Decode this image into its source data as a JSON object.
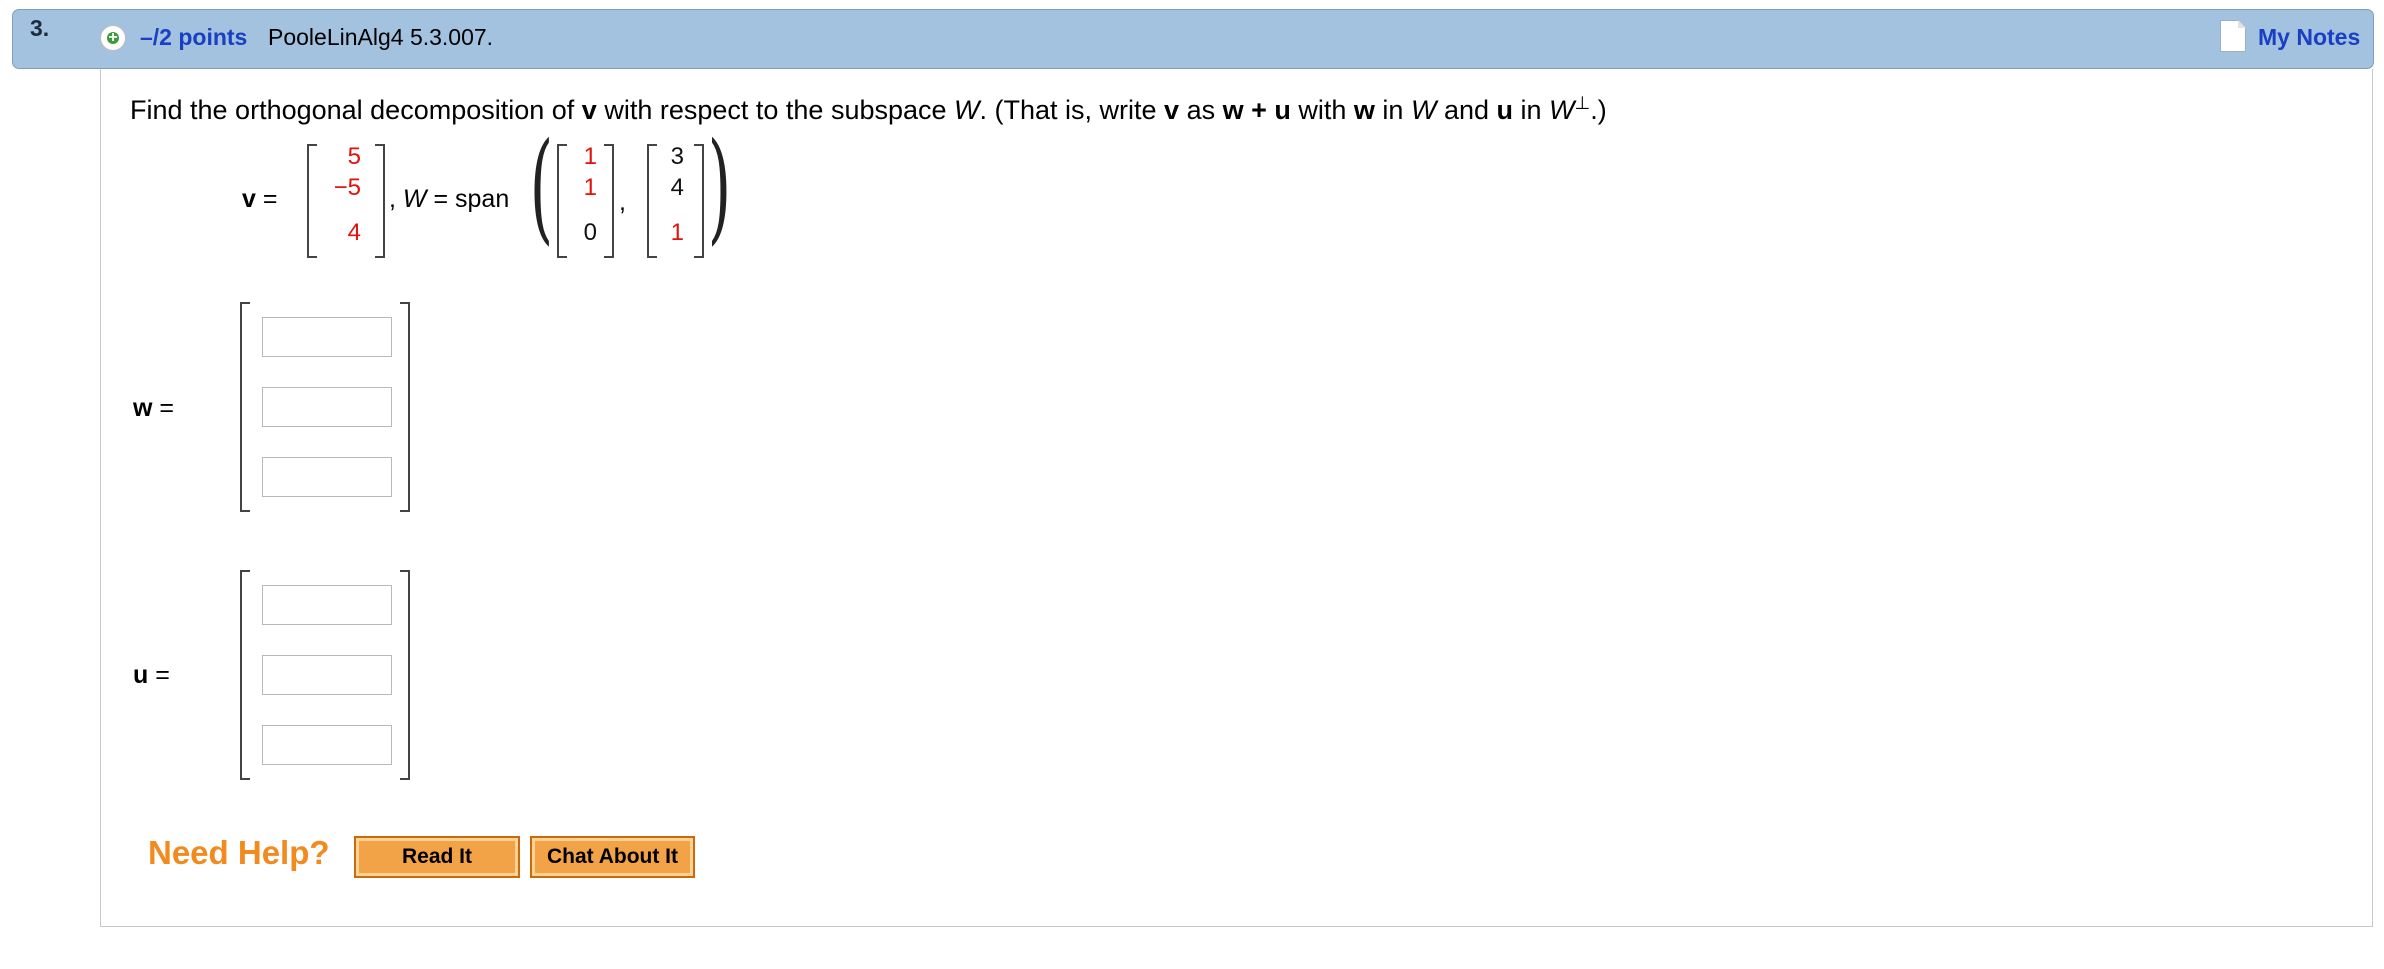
{
  "header": {
    "question_number": "3.",
    "points": "–/2 points",
    "problem_id": "PooleLinAlg4 5.3.007.",
    "my_notes_label": "My Notes",
    "icons": {
      "add": "plus-circle-icon",
      "notes": "document-icon"
    }
  },
  "question": {
    "prefix": "Find the orthogonal decomposition of ",
    "v": "v",
    "text2": " with respect to the subspace ",
    "W": "W",
    "text3": ". (That is, write ",
    "v2": "v",
    "text4": " as ",
    "wpu": "w + u",
    "text5": " with ",
    "w": "w",
    "text6": " in ",
    "W2": "W",
    "text7": " and ",
    "u": "u",
    "text8": " in ",
    "W3": "W",
    "perp": "⊥",
    "suffix": ".)"
  },
  "given": {
    "v_label": "v",
    "equals": "=",
    "v_entries": [
      "5",
      "−5",
      "4"
    ],
    "comma_W": ",",
    "W_label": "W",
    "span_text": "= span",
    "basis1": [
      "1",
      "1",
      "0"
    ],
    "basis_comma": ",",
    "basis2": [
      "3",
      "4",
      "1"
    ]
  },
  "answers": {
    "w_label": "w",
    "u_label": "u",
    "equals": "=",
    "w_values": [
      "",
      "",
      ""
    ],
    "u_values": [
      "",
      "",
      ""
    ]
  },
  "help": {
    "need_help": "Need Help?",
    "read_it": "Read It",
    "chat_about_it": "Chat About It"
  },
  "colors": {
    "header_bg": "#a2c2df",
    "link_blue": "#1a3fc2",
    "red_value": "#e0120d",
    "help_orange": "#f28a1d",
    "button_orange": "#f2a347"
  }
}
